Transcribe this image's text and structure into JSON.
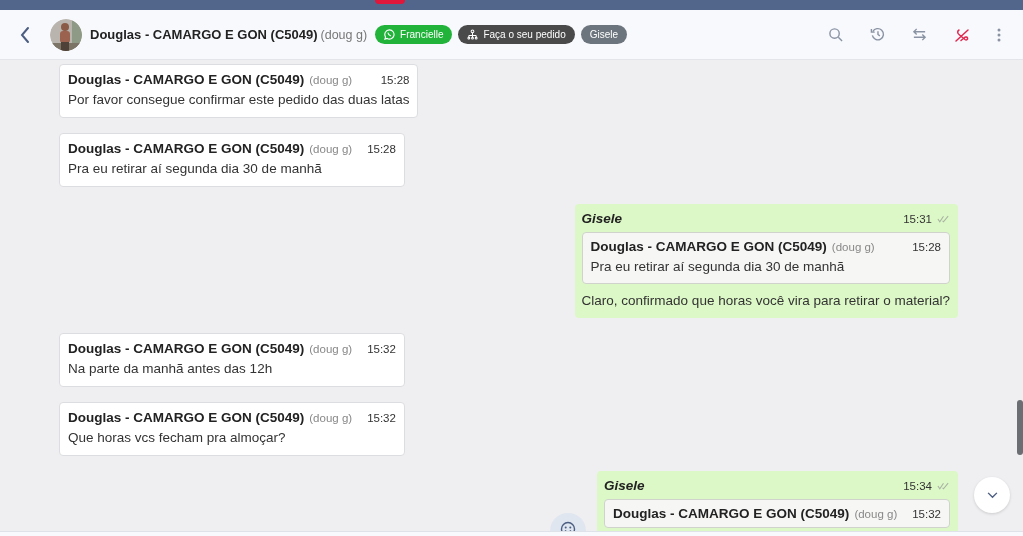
{
  "header": {
    "contact_name": "Douglas - CAMARGO E GON (C5049)",
    "contact_handle": "(doug g)",
    "tags": [
      {
        "kind": "whatsapp",
        "label": "Francielle",
        "color": "#22b33a"
      },
      {
        "kind": "flow",
        "label": "Faça o seu pedido",
        "color": "#4a4a4a"
      },
      {
        "kind": "plain",
        "label": "Gisele",
        "color": "#6c757d"
      }
    ]
  },
  "messages": [
    {
      "kind": "incoming",
      "author": "Douglas - CAMARGO E GON (C5049)",
      "handle": "(doug g)",
      "time": "15:28",
      "text": "Por favor consegue confirmar este pedido das duas latas"
    },
    {
      "kind": "incoming",
      "author": "Douglas - CAMARGO E GON (C5049)",
      "handle": "(doug g)",
      "time": "15:28",
      "text": "Pra eu retirar aí segunda dia 30 de manhã"
    },
    {
      "kind": "outgoing",
      "author": "Gisele",
      "time": "15:31",
      "quote": {
        "author": "Douglas - CAMARGO E GON (C5049)",
        "handle": "(doug g)",
        "time": "15:28",
        "text": "Pra eu retirar aí segunda dia 30 de manhã"
      },
      "text": "Claro, confirmado que horas você vira para retirar o material?"
    },
    {
      "kind": "incoming",
      "author": "Douglas - CAMARGO E GON (C5049)",
      "handle": "(doug g)",
      "time": "15:32",
      "text": "Na parte da manhã antes das 12h"
    },
    {
      "kind": "incoming",
      "author": "Douglas - CAMARGO E GON (C5049)",
      "handle": "(doug g)",
      "time": "15:32",
      "text": "Que horas vcs fecham pra almoçar?"
    },
    {
      "kind": "outgoing",
      "author": "Gisele",
      "time": "15:34",
      "quote": {
        "author": "Douglas - CAMARGO E GON (C5049)",
        "handle": "(doug g)",
        "time": "15:32"
      }
    }
  ]
}
